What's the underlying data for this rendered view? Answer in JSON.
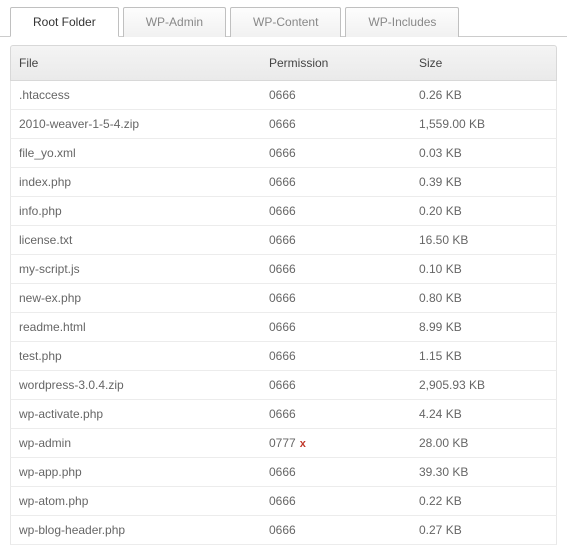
{
  "tabs": [
    {
      "label": "Root Folder",
      "active": true
    },
    {
      "label": "WP-Admin",
      "active": false
    },
    {
      "label": "WP-Content",
      "active": false
    },
    {
      "label": "WP-Includes",
      "active": false
    }
  ],
  "columns": {
    "file": "File",
    "permission": "Permission",
    "size": "Size"
  },
  "rows": [
    {
      "file": ".htaccess",
      "permission": "0666",
      "warn": false,
      "size": "0.26 KB"
    },
    {
      "file": "2010-weaver-1-5-4.zip",
      "permission": "0666",
      "warn": false,
      "size": "1,559.00 KB"
    },
    {
      "file": "file_yo.xml",
      "permission": "0666",
      "warn": false,
      "size": "0.03 KB"
    },
    {
      "file": "index.php",
      "permission": "0666",
      "warn": false,
      "size": "0.39 KB"
    },
    {
      "file": "info.php",
      "permission": "0666",
      "warn": false,
      "size": "0.20 KB"
    },
    {
      "file": "license.txt",
      "permission": "0666",
      "warn": false,
      "size": "16.50 KB"
    },
    {
      "file": "my-script.js",
      "permission": "0666",
      "warn": false,
      "size": "0.10 KB"
    },
    {
      "file": "new-ex.php",
      "permission": "0666",
      "warn": false,
      "size": "0.80 KB"
    },
    {
      "file": "readme.html",
      "permission": "0666",
      "warn": false,
      "size": "8.99 KB"
    },
    {
      "file": "test.php",
      "permission": "0666",
      "warn": false,
      "size": "1.15 KB"
    },
    {
      "file": "wordpress-3.0.4.zip",
      "permission": "0666",
      "warn": false,
      "size": "2,905.93 KB"
    },
    {
      "file": "wp-activate.php",
      "permission": "0666",
      "warn": false,
      "size": "4.24 KB"
    },
    {
      "file": "wp-admin",
      "permission": "0777",
      "warn": true,
      "size": "28.00 KB"
    },
    {
      "file": "wp-app.php",
      "permission": "0666",
      "warn": false,
      "size": "39.30 KB"
    },
    {
      "file": "wp-atom.php",
      "permission": "0666",
      "warn": false,
      "size": "0.22 KB"
    },
    {
      "file": "wp-blog-header.php",
      "permission": "0666",
      "warn": false,
      "size": "0.27 KB"
    }
  ],
  "warn_mark": "x"
}
